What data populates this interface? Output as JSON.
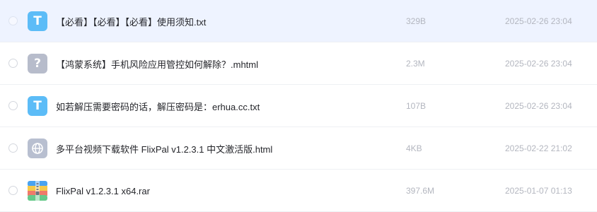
{
  "files": [
    {
      "name": "【必看】【必看】【必看】使用须知.txt",
      "size": "329B",
      "date": "2025-02-26 23:04",
      "icon": "txt-file-icon",
      "icon_glyph": "T"
    },
    {
      "name": "【鸿蒙系统】手机风险应用管控如何解除？.mhtml",
      "size": "2.3M",
      "date": "2025-02-26 23:04",
      "icon": "unknown-file-icon",
      "icon_glyph": "?"
    },
    {
      "name": "如若解压需要密码的话，解压密码是：erhua.cc.txt",
      "size": "107B",
      "date": "2025-02-26 23:04",
      "icon": "txt-file-icon",
      "icon_glyph": "T"
    },
    {
      "name": "多平台视频下载软件 FlixPal v1.2.3.1 中文激活版.html",
      "size": "4KB",
      "date": "2025-02-22 21:02",
      "icon": "html-file-icon"
    },
    {
      "name": "FlixPal v1.2.3.1 x64.rar",
      "size": "397.6M",
      "date": "2025-01-07 01:13",
      "icon": "rar-archive-icon"
    }
  ],
  "colors": {
    "selected_row_bg": "#eef3ff",
    "txt_icon": "#5cbcf7",
    "unknown_icon": "#b7bccb",
    "meta_text": "#b3b6bf"
  }
}
